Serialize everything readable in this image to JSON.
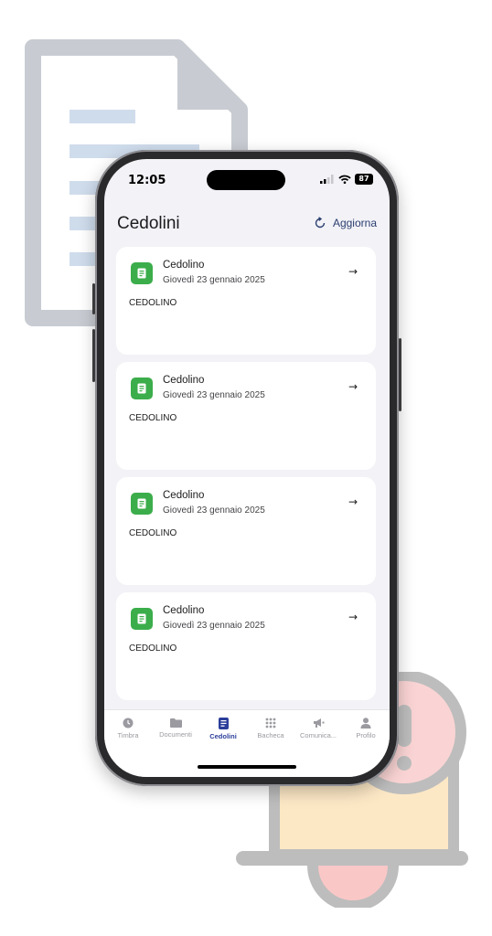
{
  "status_bar": {
    "time": "12:05",
    "battery": "87"
  },
  "header": {
    "title": "Cedolini",
    "refresh_label": "Aggiorna"
  },
  "cards": [
    {
      "title": "Cedolino",
      "date": "Giovedì 23 gennaio 2025",
      "description": "CEDOLINO"
    },
    {
      "title": "Cedolino",
      "date": "Giovedì 23 gennaio 2025",
      "description": "CEDOLINO"
    },
    {
      "title": "Cedolino",
      "date": "Giovedì 23 gennaio 2025",
      "description": "CEDOLINO"
    },
    {
      "title": "Cedolino",
      "date": "Giovedì 23 gennaio 2025",
      "description": "CEDOLINO"
    }
  ],
  "tabs": [
    {
      "label": "Timbra",
      "icon": "clock-icon"
    },
    {
      "label": "Documenti",
      "icon": "folder-icon"
    },
    {
      "label": "Cedolini",
      "icon": "document-icon",
      "active": true
    },
    {
      "label": "Bacheca",
      "icon": "grid-icon"
    },
    {
      "label": "Comunica...",
      "icon": "megaphone-icon"
    },
    {
      "label": "Profilo",
      "icon": "person-icon"
    }
  ],
  "colors": {
    "accent": "#2b3e6f",
    "card_icon": "#3bad4b",
    "background": "#f2f2f7"
  }
}
